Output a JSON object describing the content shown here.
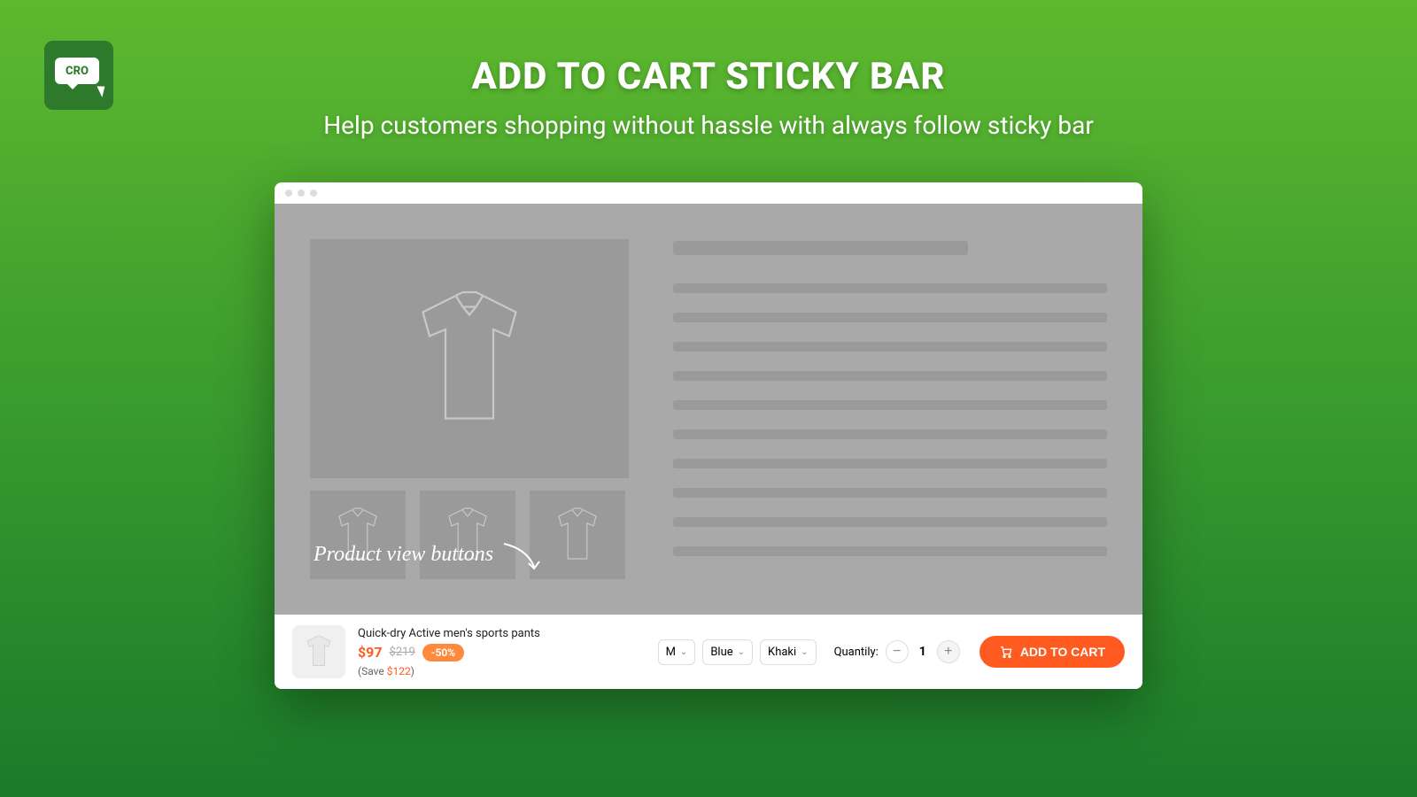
{
  "logo": {
    "text": "CRO"
  },
  "hero": {
    "title": "ADD TO CART STICKY BAR",
    "subtitle": "Help customers shopping without hassle with always follow sticky bar"
  },
  "annotation": "Product view buttons",
  "sticky": {
    "product_title": "Quick-dry Active men's sports pants",
    "price": "$97",
    "old_price": "$219",
    "discount_badge": "-50%",
    "save_prefix": "(Save ",
    "save_amount": "$122",
    "save_suffix": ")",
    "size_option": "M",
    "color_option": "Blue",
    "variant_option": "Khaki",
    "quantity_label": "Quantily:",
    "quantity_value": "1",
    "add_to_cart_label": "ADD TO CART"
  }
}
